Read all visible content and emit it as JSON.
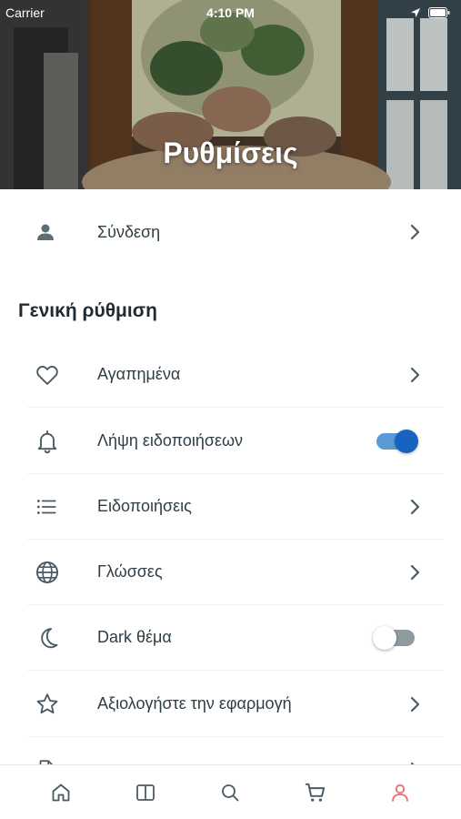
{
  "status_bar": {
    "carrier": "Carrier",
    "time": "4:10 PM"
  },
  "header": {
    "title": "Ρυθμίσεις"
  },
  "login_row": {
    "label": "Σύνδεση",
    "icon": "person-icon"
  },
  "section": {
    "title": "Γενική ρύθμιση"
  },
  "settings": [
    {
      "label": "Αγαπημένα",
      "icon": "heart-icon",
      "control": "chevron"
    },
    {
      "label": "Λήψη ειδοποιήσεων",
      "icon": "bell-icon",
      "control": "toggle",
      "toggle_on": true
    },
    {
      "label": "Ειδοποιήσεις",
      "icon": "list-icon",
      "control": "chevron"
    },
    {
      "label": "Γλώσσες",
      "icon": "globe-icon",
      "control": "chevron"
    },
    {
      "label": "Dark θέμα",
      "icon": "moon-icon",
      "control": "toggle",
      "toggle_on": false
    },
    {
      "label": "Αξιολογήστε την εφαρμογή",
      "icon": "star-icon",
      "control": "chevron"
    }
  ],
  "tabs": [
    {
      "name": "home",
      "icon": "home-icon",
      "active": false
    },
    {
      "name": "catalog",
      "icon": "book-icon",
      "active": false
    },
    {
      "name": "search",
      "icon": "search-icon",
      "active": false
    },
    {
      "name": "cart",
      "icon": "cart-icon",
      "active": false
    },
    {
      "name": "profile",
      "icon": "user-icon",
      "active": true
    }
  ],
  "colors": {
    "text": "#2f3d45",
    "icon": "#4a5a62",
    "toggle_on": "#1565c0",
    "toggle_off": "#8f9aa1",
    "tab_active": "#f06a6a",
    "tab_inactive": "#4a5a62"
  }
}
